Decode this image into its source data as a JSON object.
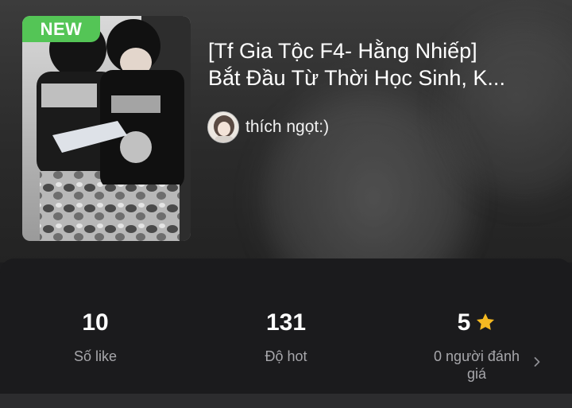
{
  "badge": {
    "label": "NEW"
  },
  "story": {
    "title_line1": "[Tf Gia Tộc F4- Hằng Nhiếp]",
    "title_line2": "Bắt Đầu Từ Thời Học Sinh, K..."
  },
  "author": {
    "name": "thích ngọt:)"
  },
  "stats": {
    "likes": {
      "value": "10",
      "label": "Số like"
    },
    "hot": {
      "value": "131",
      "label": "Độ hot"
    },
    "rating": {
      "value": "5",
      "label": "0 người đánh giá"
    }
  },
  "colors": {
    "badge_green": "#54c556",
    "star_gold": "#f5b921",
    "panel": "#1b1b1d"
  },
  "icons": {
    "rating_star": "star-icon",
    "rating_more": "chevron-right-icon"
  }
}
